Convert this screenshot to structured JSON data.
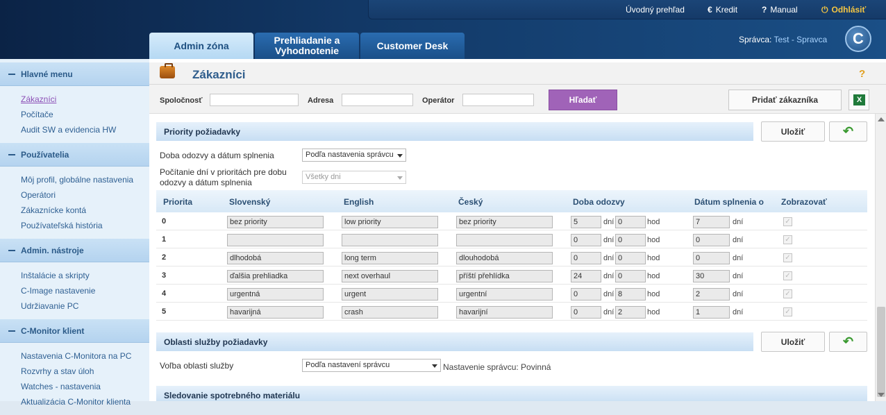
{
  "topnav": {
    "overview": "Úvodný prehľad",
    "credit": "Kredit",
    "manual": "Manual",
    "logout": "Odhlásiť",
    "credit_icon": "euro-icon",
    "manual_icon": "question-icon",
    "logout_icon": "power-icon"
  },
  "tabs": [
    {
      "label": "Admin zóna",
      "active": true
    },
    {
      "label": "Prehliadanie a Vyhodnotenie",
      "active": false
    },
    {
      "label": "Customer Desk",
      "active": false
    }
  ],
  "manager": {
    "label": "Správca:",
    "name": "Test - Spravca"
  },
  "logo_letter": "C",
  "sidebar": {
    "sections": [
      {
        "title": "Hlavné menu",
        "items": [
          "Zákazníci",
          "Počítače",
          "Audit SW a evidencia HW"
        ]
      },
      {
        "title": "Používatelia",
        "items": [
          "Môj profil, globálne nastavenia",
          "Operátori",
          "Zákaznícke kontá",
          "Používateľská história"
        ]
      },
      {
        "title": "Admin. nástroje",
        "items": [
          "Inštalácie a skripty",
          "C-Image nastavenie",
          "Udržiavanie PC"
        ]
      },
      {
        "title": "C-Monitor klient",
        "items": [
          "Nastavenia C-Monitora na PC",
          "Rozvrhy a stav úloh",
          "Watches - nastavenia",
          "Aktualizácia C-Monitor klienta"
        ]
      }
    ],
    "current": "Zákazníci"
  },
  "page": {
    "title": "Zákazníci",
    "help": "?"
  },
  "filters": {
    "company_label": "Spoločnosť",
    "address_label": "Adresa",
    "operator_label": "Operátor",
    "company_value": "",
    "address_value": "",
    "operator_value": "",
    "search_button": "Hľadať",
    "add_button": "Pridať zákazníka",
    "excel_icon": "excel-icon",
    "excel_letter": "X"
  },
  "priorities_section": {
    "title": "Priority požiadavky",
    "save": "Uložiť",
    "back_icon": "undo-arrow-icon",
    "response_label": "Doba odozvy a dátum splnenia",
    "response_value": "Podľa nastavenia správcu",
    "counting_label": "Počítanie dní v prioritách pre dobu odozvy a dátum splnenia",
    "counting_value": "Všetky dni",
    "columns": [
      "Priorita",
      "Slovenský",
      "English",
      "Český",
      "Doba odozvy",
      "Dátum splnenia o",
      "Zobrazovať"
    ],
    "unit_days": "dní",
    "unit_hours": "hod",
    "rows": [
      {
        "priority": "0",
        "sk": "bez priority",
        "en": "low priority",
        "cz": "bez priority",
        "resp_days": "5",
        "resp_hours": "0",
        "due_days": "7",
        "show": true
      },
      {
        "priority": "1",
        "sk": "",
        "en": "",
        "cz": "",
        "resp_days": "0",
        "resp_hours": "0",
        "due_days": "0",
        "show": true
      },
      {
        "priority": "2",
        "sk": "dlhodobá",
        "en": "long term",
        "cz": "dlouhodobá",
        "resp_days": "0",
        "resp_hours": "0",
        "due_days": "0",
        "show": true
      },
      {
        "priority": "3",
        "sk": "ďalšia prehliadka",
        "en": "next overhaul",
        "cz": "příští přehlídka",
        "resp_days": "24",
        "resp_hours": "0",
        "due_days": "30",
        "show": true
      },
      {
        "priority": "4",
        "sk": "urgentná",
        "en": "urgent",
        "cz": "urgentní",
        "resp_days": "0",
        "resp_hours": "8",
        "due_days": "2",
        "show": true
      },
      {
        "priority": "5",
        "sk": "havarijná",
        "en": "crash",
        "cz": "havarijní",
        "resp_days": "0",
        "resp_hours": "2",
        "due_days": "1",
        "show": true
      }
    ]
  },
  "service_section": {
    "title": "Oblasti služby požiadavky",
    "save": "Uložiť",
    "choice_label": "Voľba oblasti služby",
    "choice_value": "Podľa nastavení správcu",
    "note": "Nastavenie správcu: Povinná"
  },
  "consumables_section": {
    "title": "Sledovanie spotrebného materiálu"
  },
  "colors": {
    "accent_purple": "#a063b8",
    "header_dark": "#123866",
    "link_blue": "#2e5f92"
  }
}
